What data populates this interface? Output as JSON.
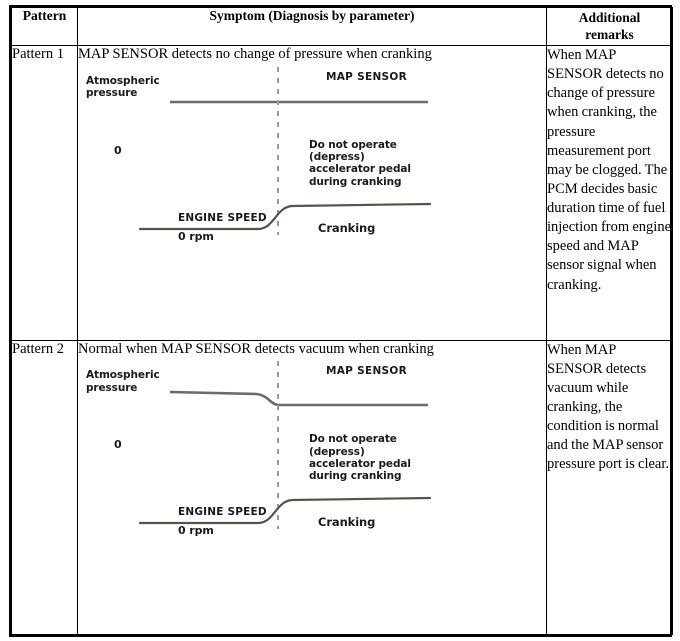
{
  "table": {
    "headers": {
      "pattern": "Pattern",
      "symptom": "Symptom (Diagnosis by parameter)",
      "remarks_line1": "Additional",
      "remarks_line2": "remarks"
    },
    "rows": [
      {
        "pattern": "Pattern 1",
        "symptom": "MAP SENSOR detects no change of pressure when cranking",
        "remarks": "When MAP SENSOR detects no change of pressure when cranking, the pressure measurement port may be clogged. The PCM decides basic duration time of fuel injection from engine speed and MAP sensor signal when cranking.",
        "diagram": {
          "atmospheric_label": "Atmospheric\npressure",
          "zero_label": "0",
          "map_sensor_label": "MAP SENSOR",
          "note_label": "Do not operate\n(depress)\naccelerator pedal\nduring cranking",
          "engine_speed_label": "ENGINE SPEED",
          "zero_rpm_label": "0 rpm",
          "cranking_label": "Cranking",
          "map_signal_shape": "flat"
        }
      },
      {
        "pattern": "Pattern 2",
        "symptom": "Normal when MAP SENSOR detects vacuum when cranking",
        "remarks": "When MAP SENSOR detects vacuum while cranking, the condition is normal and the MAP sensor pressure port is clear.",
        "diagram": {
          "atmospheric_label": "Atmospheric\npressure",
          "zero_label": "0",
          "map_sensor_label": "MAP SENSOR",
          "note_label": "Do not operate\n(depress)\naccelerator pedal\nduring cranking",
          "engine_speed_label": "ENGINE SPEED",
          "zero_rpm_label": "0 rpm",
          "cranking_label": "Cranking",
          "map_signal_shape": "drops-to-vacuum"
        }
      }
    ]
  },
  "colors": {
    "border": "#000000",
    "trace": "#6b6b6b",
    "dashed_marker": "#9a9a9a",
    "text": "#000000"
  }
}
